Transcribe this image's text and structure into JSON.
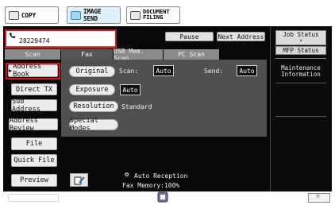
{
  "modes": [
    {
      "label": "COPY",
      "icon": "copy-icon",
      "active": false
    },
    {
      "label": "IMAGE SEND",
      "icon": "image-send-icon",
      "active": true
    },
    {
      "label_line1": "DOCUMENT",
      "label_line2": "FILING",
      "icon": "document-filing-icon",
      "active": false
    }
  ],
  "destination": {
    "number": "28229474",
    "icon": "phone-receiver-icon"
  },
  "top_buttons": {
    "pause": "Pause",
    "next_address": "Next Address"
  },
  "tabs": [
    "Scan",
    "Fax",
    "USB Mem. Scan",
    "PC Scan"
  ],
  "active_tab": "Fax",
  "side_buttons": [
    "Address Book",
    "Direct TX",
    "Sub Address",
    "Address Review",
    "File",
    "Quick File",
    "Preview"
  ],
  "options": {
    "original_label": "Original",
    "scan_label": "Scan:",
    "scan_value": "Auto",
    "send_label": "Send:",
    "send_value": "Auto",
    "exposure_label": "Exposure",
    "exposure_value": "Auto",
    "resolution_label": "Resolution",
    "resolution_value": "Standard",
    "special_modes_label": "Special Modes"
  },
  "status": {
    "auto_reception": "Auto Reception",
    "fax_memory": "Fax Memory:100%"
  },
  "right_panel": {
    "job_status_label": "Job Status",
    "mfp_status_label": "MFP Status",
    "maintenance_line1": "Maintenance",
    "maintenance_line2": "Information"
  },
  "colors": {
    "highlight_frame": "#e0121b",
    "active_mode_tab": "#dff1fb",
    "panel_background": "#080808"
  }
}
